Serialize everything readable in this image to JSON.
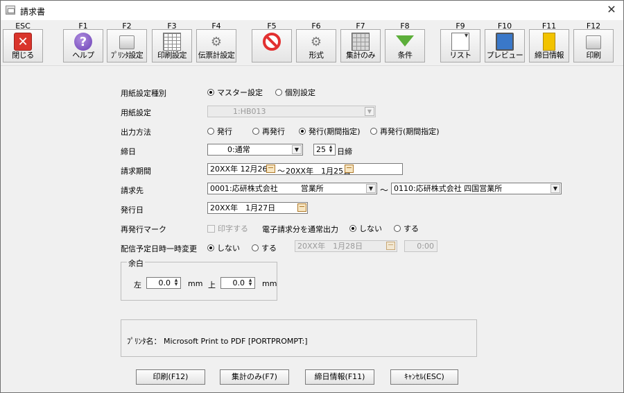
{
  "window": {
    "title": "請求書",
    "close_symbol": "✕"
  },
  "toolbar": [
    {
      "key": "ESC",
      "label": "閉じる",
      "icon": "close-icon",
      "glyph": "✕"
    },
    {
      "key": "F1",
      "label": "ヘルプ",
      "icon": "help-icon",
      "glyph": "?"
    },
    {
      "key": "F2",
      "label": "ﾌﾟﾘﾝﾀ設定",
      "icon": "printer-icon",
      "glyph": ""
    },
    {
      "key": "F3",
      "label": "印刷設定",
      "icon": "sheet-icon",
      "glyph": ""
    },
    {
      "key": "F4",
      "label": "伝票計設定",
      "icon": "gear-icon",
      "glyph": "⚙"
    },
    {
      "key": "F5",
      "label": "",
      "icon": "prohibited-icon",
      "glyph": ""
    },
    {
      "key": "F6",
      "label": "形式",
      "icon": "gear-icon",
      "glyph": "⚙"
    },
    {
      "key": "F7",
      "label": "集計のみ",
      "icon": "calculator-icon",
      "glyph": ""
    },
    {
      "key": "F8",
      "label": "条件",
      "icon": "funnel-icon",
      "glyph": ""
    },
    {
      "key": "F9",
      "label": "リスト",
      "icon": "list-icon",
      "glyph": ""
    },
    {
      "key": "F10",
      "label": "プレビュー",
      "icon": "monitor-icon",
      "glyph": ""
    },
    {
      "key": "F11",
      "label": "締日情報",
      "icon": "folder-icon",
      "glyph": ""
    },
    {
      "key": "F12",
      "label": "印刷",
      "icon": "printer-icon",
      "glyph": ""
    }
  ],
  "form": {
    "paper_type": {
      "label": "用紙設定種別",
      "options": [
        "マスター設定",
        "個別設定"
      ],
      "selected": 0
    },
    "paper_setting": {
      "label": "用紙設定",
      "value": "1:HB013"
    },
    "output_method": {
      "label": "出力方法",
      "options": [
        "発行",
        "再発行",
        "発行(期間指定)",
        "再発行(期間指定)"
      ],
      "selected": 2
    },
    "closing_date": {
      "label": "締日",
      "value": "0:通常",
      "day": "25",
      "suffix": "日締"
    },
    "period": {
      "label": "請求期間",
      "from": "20XX年 12月26日",
      "separator": "～",
      "to": "20XX年　1月25日"
    },
    "billing_to": {
      "label": "請求先",
      "from": "0001:応研株式会社　　　営業所",
      "separator": "～",
      "to": "0110:応研株式会社 四国営業所"
    },
    "issue_date": {
      "label": "発行日",
      "value": "20XX年　1月27日"
    },
    "reissue_mark": {
      "label": "再発行マーク",
      "check_label": "印字する",
      "electronic_label": "電子請求分を通常出力",
      "options": [
        "しない",
        "する"
      ],
      "selected": 0
    },
    "delivery_change": {
      "label": "配信予定日時一時変更",
      "options": [
        "しない",
        "する"
      ],
      "selected": 0,
      "date": "20XX年　1月28日",
      "time": "0:00"
    },
    "margin": {
      "title": "余白",
      "left_label": "左",
      "left_value": "0.0",
      "top_label": "上",
      "top_value": "0.0",
      "unit": "mm"
    },
    "printer": {
      "text": "ﾌﾟﾘﾝﾀ名： Microsoft Print to PDF  [PORTPROMPT:]"
    }
  },
  "buttons": {
    "print": "印刷(F12)",
    "summary": "集計のみ(F7)",
    "closing_info": "締日情報(F11)",
    "cancel": "ｷｬﾝｾﾙ(ESC)"
  }
}
